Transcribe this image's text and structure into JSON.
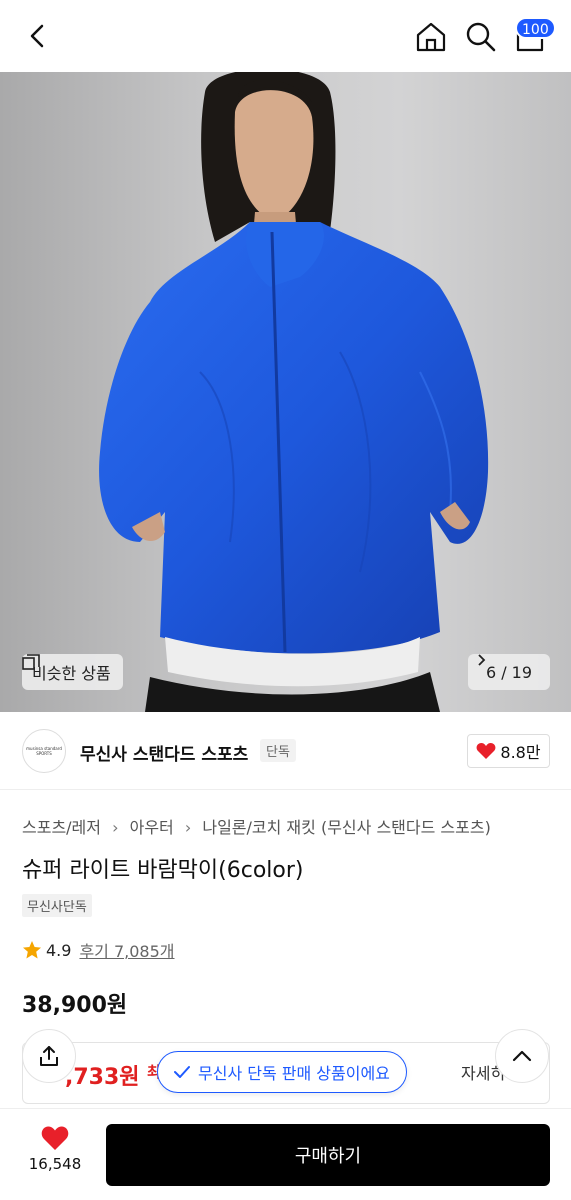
{
  "header": {
    "cart_count": "100",
    "icons": [
      "back-arrow-icon",
      "home-icon",
      "search-icon",
      "cart-icon"
    ]
  },
  "hero": {
    "similar_label": "비슷한 상품",
    "image_counter": "6 / 19"
  },
  "brand": {
    "logo_text": "musinsa standard SPORTS",
    "name": "무신사 스탠다드 스포츠",
    "tag": "단독",
    "likes": "8.8만"
  },
  "product": {
    "breadcrumb": [
      "스포츠/레저",
      "아우터",
      "나일론/코치 재킷 (무신사 스탠다드 스포츠)"
    ],
    "title": "슈퍼 라이트 바람막이(6color)",
    "badge": "무신사단독",
    "rating": "4.9",
    "reviews": "후기 7,085개",
    "price": "38,900원"
  },
  "benefit": {
    "price_partial": ",733원",
    "small_partial": "최",
    "detail_partial": "자세히"
  },
  "toast": {
    "text": "무신사 단독 판매 상품이에요"
  },
  "bottom": {
    "wish_count": "16,548",
    "buy_label": "구매하기"
  },
  "colors": {
    "accent": "#1e5aff",
    "sale": "#e02020",
    "heart": "#e8202a",
    "jacket": "#1f5de0"
  }
}
